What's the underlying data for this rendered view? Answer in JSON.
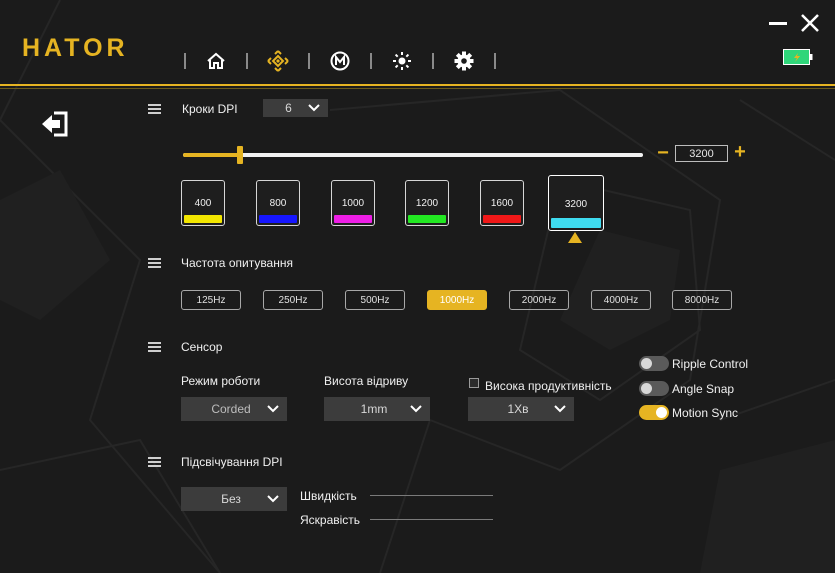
{
  "header": {
    "logo": "HATOR",
    "nav": [
      "home-icon",
      "dpi-target-icon",
      "macro-m-icon",
      "lighting-sun-icon",
      "gear-icon"
    ],
    "accent_color": "#e6b422",
    "battery_color": "#2fd67a"
  },
  "dpi": {
    "title": "Кроки DPI",
    "steps_value": "6",
    "slider_value": 3200,
    "slider_max": 26000,
    "value_display": "3200",
    "minus": "−",
    "plus": "+",
    "stages": [
      {
        "value": "400",
        "color": "#f2e600"
      },
      {
        "value": "800",
        "color": "#1616ff"
      },
      {
        "value": "1000",
        "color": "#ee1ee6"
      },
      {
        "value": "1200",
        "color": "#22e822"
      },
      {
        "value": "1600",
        "color": "#f01818"
      },
      {
        "value": "3200",
        "color": "#3fdcf0"
      }
    ],
    "active_stage": 5
  },
  "polling": {
    "title": "Частота опитування",
    "options": [
      "125Hz",
      "250Hz",
      "500Hz",
      "1000Hz",
      "2000Hz",
      "4000Hz",
      "8000Hz"
    ],
    "selected": 3
  },
  "sensor": {
    "title": "Сенсор",
    "mode_label": "Режим роботи",
    "mode_value": "Corded",
    "lod_label": "Висота відриву",
    "lod_value": "1mm",
    "hp_label": "Висока продуктивність",
    "hp_value": "1Xв",
    "toggles": [
      {
        "label": "Ripple Control",
        "on": false
      },
      {
        "label": "Angle Snap",
        "on": false
      },
      {
        "label": "Motion Sync",
        "on": true
      }
    ]
  },
  "dpi_light": {
    "title": "Підсвічування DPI",
    "effect_value": "Без",
    "speed_label": "Швидкість",
    "brightness_label": "Яскравість"
  }
}
